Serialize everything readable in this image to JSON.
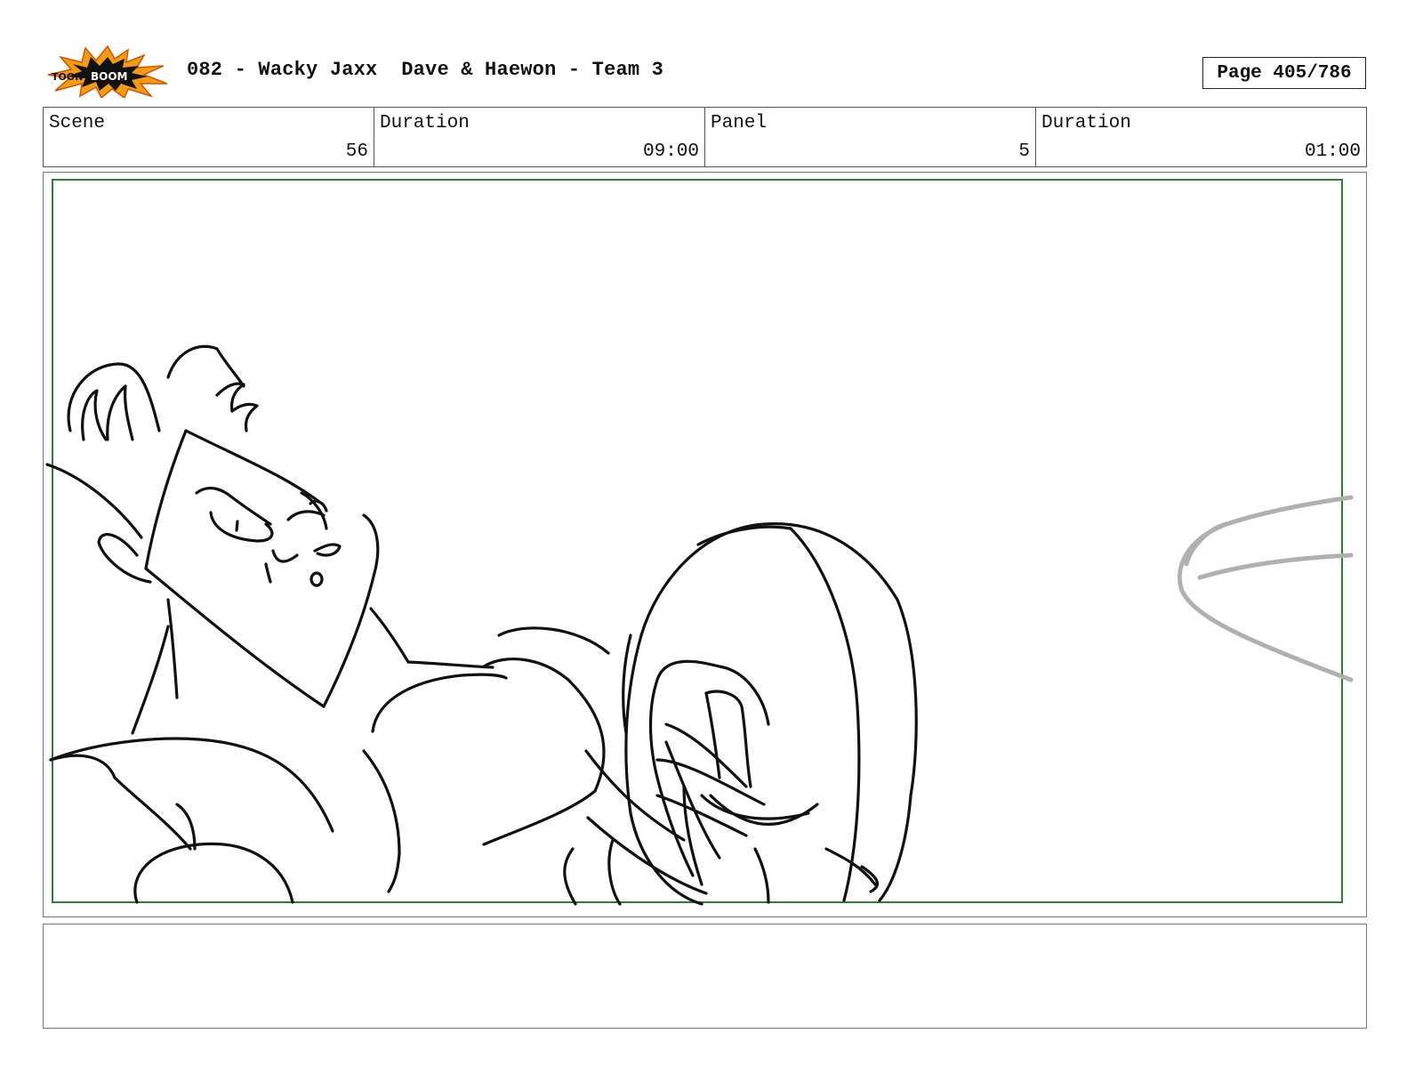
{
  "header": {
    "logo_icon": "toon-boom-logo-icon",
    "title": "082 - Wacky Jaxx  Dave & Haewon - Team 3",
    "page": "Page 405/786"
  },
  "info": {
    "scene_label": "Scene",
    "scene_value": "56",
    "scene_duration_label": "Duration",
    "scene_duration_value": "09:00",
    "panel_label": "Panel",
    "panel_value": "5",
    "panel_duration_label": "Duration",
    "panel_duration_value": "01:00"
  },
  "panel": {
    "safe_frame_color": "#2e7d32",
    "sketch_icon": "storyboard-sketch-icon"
  },
  "notes": {
    "text": ""
  }
}
